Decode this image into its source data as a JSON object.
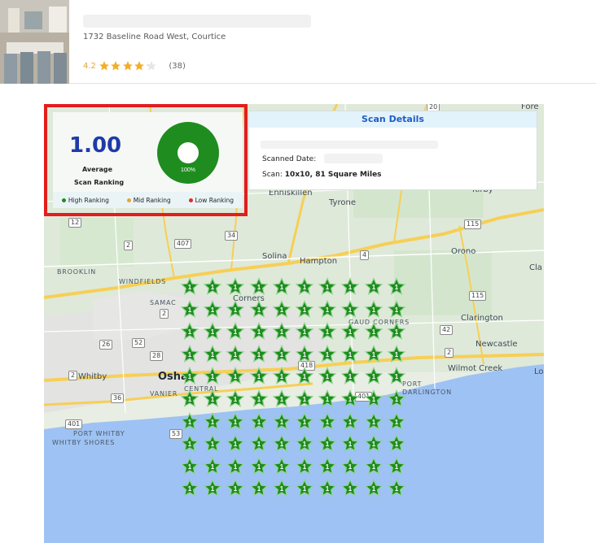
{
  "business": {
    "address": "1732 Baseline Road West, Courtice",
    "rating": "4.2",
    "review_count": "(38)",
    "stars_filled": 4.2,
    "star_color": "#f2ae2a"
  },
  "rank_card": {
    "value": "1.00",
    "label_line1": "Average",
    "label_line2": "Scan Ranking",
    "donut_percent_text": "100%",
    "donut_color": "#1f8c1f",
    "legend": [
      {
        "label": "High Ranking",
        "color": "#1f8c1f"
      },
      {
        "label": "Mid Ranking",
        "color": "#e6a43a"
      },
      {
        "label": "Low Ranking",
        "color": "#d9321c"
      }
    ]
  },
  "scan_details": {
    "title": "Scan Details",
    "scanned_date_label": "Scanned Date:",
    "scan_label": "Scan:",
    "scan_value": "10x10, 81 Square Miles"
  },
  "map": {
    "labels": {
      "enniskillen": "Enniskillen",
      "tyrone": "Tyrone",
      "kirby": "Kirby",
      "orono": "Orono",
      "solina": "Solina",
      "hampton": "Hampton",
      "brooklin": "BROOKLIN",
      "windfields": "WINDFIELDS",
      "samac": "SAMAC",
      "corners": "Corners",
      "gaud_corners": "GAUD CORNERS",
      "clarington": "Clarington",
      "newcastle": "Newcastle",
      "wilmot_creek": "Wilmot Creek",
      "whitby": "Whitby",
      "oshawa": "Osha",
      "vanier": "VANIER",
      "central": "CENTRAL",
      "port_darlington": "PORT",
      "darlington": "DARLINGTON",
      "port_whitby": "PORT WHITBY",
      "whitby_shores": "WHITBY SHORES",
      "fore": "Fore",
      "cla": "Cla",
      "lo": "Lo"
    },
    "shields": [
      "12",
      "2",
      "407",
      "34",
      "115",
      "2",
      "52",
      "28",
      "42",
      "2",
      "115",
      "418",
      "401",
      "36",
      "53",
      "401",
      "4",
      "26",
      "20",
      "2"
    ],
    "pin_rank": "1",
    "pin_color": "#1f8c1f",
    "grid_rows": 10,
    "grid_cols": 10
  }
}
